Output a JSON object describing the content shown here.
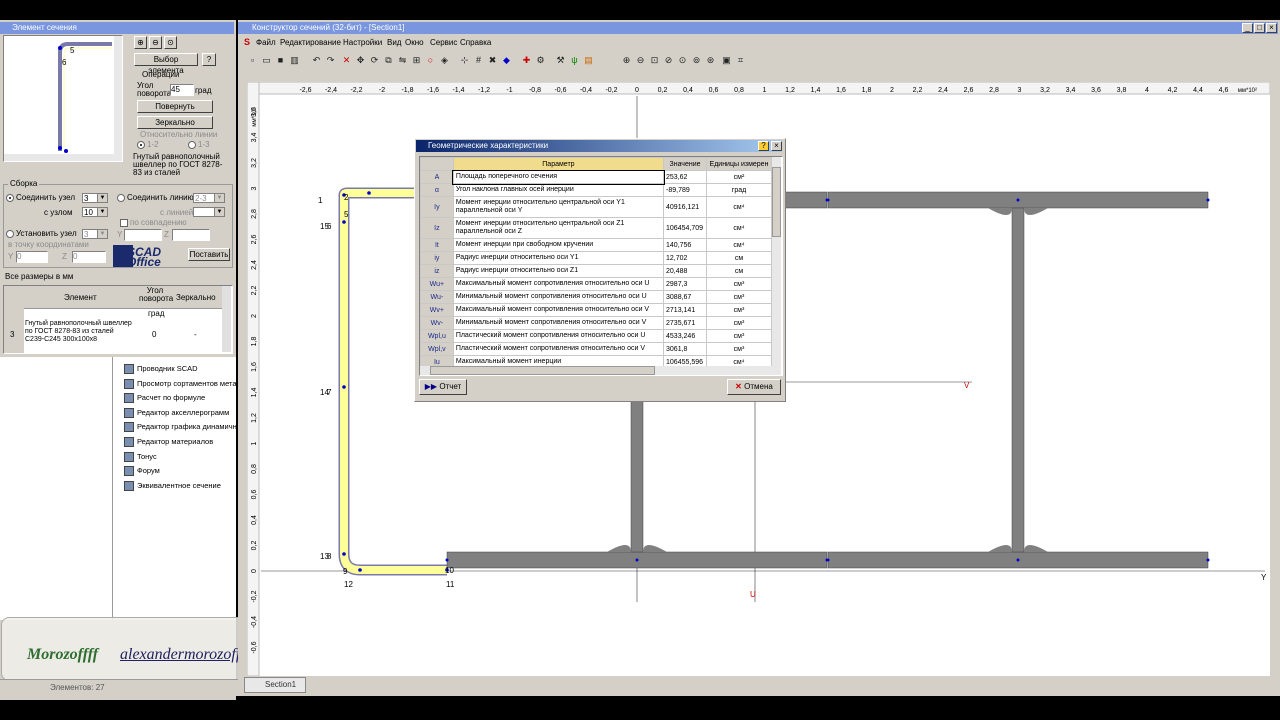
{
  "colors": {
    "titlebar": "#0a246a",
    "highlight_yellow": "#ffff99",
    "section_gray": "#808080",
    "accent_blue": "#0000cc"
  },
  "left_window": {
    "title": "Элемент сечения",
    "labels": [
      "6",
      "5",
      "6"
    ],
    "btn_select": "Выбор элемента",
    "ops_label": "Операции",
    "angle_label": "Угол поворота",
    "angle_value": "45",
    "angle_unit": "град",
    "btn_rotate": "Повернуть",
    "btn_mirror": "Зеркально",
    "rel_line": "Относительно линии",
    "r12": "1-2",
    "r13": "1-3",
    "desc": "Гнутый равнополочный швеллер по ГОСТ 8278-83 из сталей"
  },
  "assembly": {
    "group": "Сборка",
    "join_node": "Соединить узел",
    "join_node_val": "3",
    "with_node": "с узлом",
    "with_node_val": "10",
    "join_line": "Соединить линию",
    "join_line_val": "2-3",
    "with_line": "с линией",
    "by_dir": "по совпадению",
    "set_node": "Установить узел",
    "set_node_val": "3",
    "coords": "в точку координатами",
    "y_label": "Y",
    "y_val": "0",
    "z_label": "Z",
    "z_val": "0",
    "btn_place": "Поставить",
    "logo": "SCAD Office",
    "sizes": "Все размеры в мм"
  },
  "elements_table": {
    "headers": [
      "Элемент",
      "Угол поворота",
      "Зеркально"
    ],
    "units": [
      "",
      "град",
      ""
    ],
    "row": {
      "num": "3",
      "name": "Гнутый равнополочный швеллер по ГОСТ 8278-83 из сталей С239-С245 300x100x8",
      "angle": "0",
      "mirror": "-"
    }
  },
  "tree_items": [
    "Проводник SCAD",
    "Просмотр сортаментов метал",
    "Расчет по формуле",
    "Редактор акселлерограмм",
    "Редактор графика динамичн",
    "Редактор материалов",
    "Тонус",
    "Форум",
    "Эквивалентное сечение"
  ],
  "main_window": {
    "title": "Конструктор сечений (32-бит) - [Section1]",
    "menu": [
      "Файл",
      "Редактирование",
      "Настройки",
      "Вид",
      "Окно",
      "Сервис",
      "Справка"
    ],
    "tab": "Section1",
    "status": "Элементов: 27",
    "axis_unit_x": "мм*10²",
    "axis_unit_y": "мм*10²",
    "axis_y": "Y",
    "axis_z": "Z",
    "axis_u": "U",
    "axis_v": "V",
    "x_ticks": [
      "-2,6",
      "-2,4",
      "-2,2",
      "-2",
      "-1,8",
      "-1,6",
      "-1,4",
      "-1,2",
      "-1",
      "-0,8",
      "-0,6",
      "-0,4",
      "-0,2",
      "0",
      "0,2",
      "0,4",
      "0,6",
      "0,8",
      "1",
      "1,2",
      "1,4",
      "1,6",
      "1,8",
      "2",
      "2,2",
      "2,4",
      "2,6",
      "2,8",
      "3",
      "3,2",
      "3,4",
      "3,6",
      "3,8",
      "4",
      "4,2",
      "4,4",
      "4,6"
    ],
    "y_ticks": [
      "3,6",
      "3,4",
      "3,2",
      "3",
      "2,8",
      "2,6",
      "2,4",
      "2,2",
      "2",
      "1,8",
      "1,6",
      "1,4",
      "1,2",
      "1",
      "0,8",
      "0,6",
      "0,4",
      "0,2",
      "0",
      "-0,2",
      "-0,4",
      "-0,6"
    ],
    "node_labels": [
      {
        "t": "1",
        "x": 318,
        "y": 196
      },
      {
        "t": "2",
        "x": 344,
        "y": 193
      },
      {
        "t": "5",
        "x": 344,
        "y": 210
      },
      {
        "t": "15",
        "x": 320,
        "y": 222
      },
      {
        "t": "6",
        "x": 327,
        "y": 222
      },
      {
        "t": "14",
        "x": 320,
        "y": 388
      },
      {
        "t": "7",
        "x": 327,
        "y": 388
      },
      {
        "t": "13",
        "x": 320,
        "y": 552
      },
      {
        "t": "8",
        "x": 327,
        "y": 552
      },
      {
        "t": "9",
        "x": 343,
        "y": 567
      },
      {
        "t": "12",
        "x": 344,
        "y": 580
      },
      {
        "t": "10",
        "x": 445,
        "y": 566
      },
      {
        "t": "11",
        "x": 446,
        "y": 580
      }
    ]
  },
  "dialog": {
    "title": "Геометрические характеристики",
    "headers": [
      "Параметр",
      "Значение",
      "Единицы измерен"
    ],
    "rows": [
      {
        "sym": "A",
        "param": "Площадь поперечного сечения",
        "val": "253,62",
        "unit": "см²"
      },
      {
        "sym": "α",
        "param": "Угол наклона главных осей инерции",
        "val": "-89,789",
        "unit": "град"
      },
      {
        "sym": "Iy",
        "param": "Момент инерции относительно центральной оси Y1 параллельной оси Y",
        "val": "40916,121",
        "unit": "см⁴"
      },
      {
        "sym": "Iz",
        "param": "Момент инерции относительно центральной оси Z1 параллельной оси Z",
        "val": "106454,709",
        "unit": "см⁴"
      },
      {
        "sym": "It",
        "param": "Момент инерции при свободном кручении",
        "val": "140,756",
        "unit": "см⁴"
      },
      {
        "sym": "iy",
        "param": "Радиус инерции относительно оси Y1",
        "val": "12,702",
        "unit": "см"
      },
      {
        "sym": "iz",
        "param": "Радиус инерции относительно оси Z1",
        "val": "20,488",
        "unit": "см"
      },
      {
        "sym": "Wu+",
        "param": "Максимальный момент сопротивления относительно оси U",
        "val": "2987,3",
        "unit": "см³"
      },
      {
        "sym": "Wu-",
        "param": "Минимальный момент сопротивления относительно оси U",
        "val": "3088,67",
        "unit": "см³"
      },
      {
        "sym": "Wv+",
        "param": "Максимальный момент сопротивления относительно оси V",
        "val": "2713,141",
        "unit": "см³"
      },
      {
        "sym": "Wv-",
        "param": "Минимальный момент сопротивления относительно оси V",
        "val": "2735,671",
        "unit": "см³"
      },
      {
        "sym": "Wpl,u",
        "param": "Пластический момент сопротивления относительно оси U",
        "val": "4533,246",
        "unit": "см³"
      },
      {
        "sym": "Wpl,v",
        "param": "Пластический момент сопротивления относительно оси V",
        "val": "3061,8",
        "unit": "см³"
      },
      {
        "sym": "Iu",
        "param": "Максимальный момент инерции",
        "val": "106455,596",
        "unit": "см⁴"
      }
    ],
    "btn_report": "Отчет",
    "btn_cancel": "Отмена"
  },
  "watermark": {
    "name": "Morozoffff",
    "email": "alexandermorozoffffff@gmail.com"
  }
}
